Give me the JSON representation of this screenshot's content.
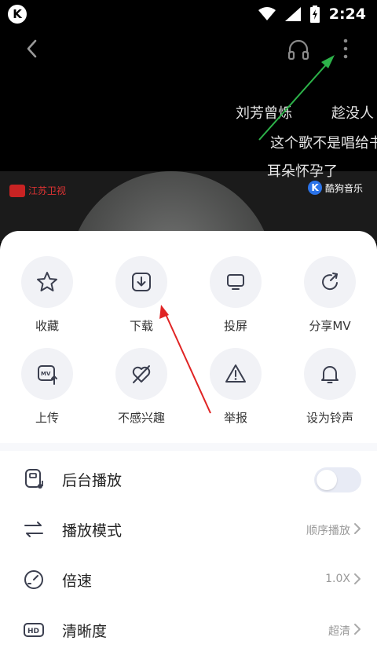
{
  "status_bar": {
    "time": "2:24",
    "app_logo": "K"
  },
  "danmaku": [
    {
      "text": "刘芳曾烁",
      "color": "#e0e0e0"
    },
    {
      "text": "趁没人",
      "color": "#e0e0e0"
    },
    {
      "text": "这个歌不是唱给书",
      "color": "#e0e0e0"
    },
    {
      "text": "耳朵怀孕了",
      "color": "#e0e0e0"
    }
  ],
  "video": {
    "channel_label": "江苏卫视",
    "brand_label": "酷狗音乐"
  },
  "actions": [
    {
      "label": "收藏",
      "icon": "star-icon"
    },
    {
      "label": "下载",
      "icon": "download-icon"
    },
    {
      "label": "投屏",
      "icon": "cast-icon"
    },
    {
      "label": "分享MV",
      "icon": "share-icon"
    },
    {
      "label": "上传",
      "icon": "upload-icon"
    },
    {
      "label": "不感兴趣",
      "icon": "dislike-icon"
    },
    {
      "label": "举报",
      "icon": "report-icon"
    },
    {
      "label": "设为铃声",
      "icon": "bell-icon"
    }
  ],
  "settings": [
    {
      "label": "后台播放",
      "value": "",
      "icon": "background-play-icon",
      "toggle_on": false
    },
    {
      "label": "播放模式",
      "value": "顺序播放",
      "icon": "play-mode-icon"
    },
    {
      "label": "倍速",
      "value": "1.0X",
      "icon": "speed-icon"
    },
    {
      "label": "清晰度",
      "value": "超清",
      "icon": "hd-icon"
    }
  ],
  "colors": {
    "arrow_green": "#2db34a",
    "arrow_red": "#e02424",
    "accent_toggle": "#e8ebf5"
  }
}
